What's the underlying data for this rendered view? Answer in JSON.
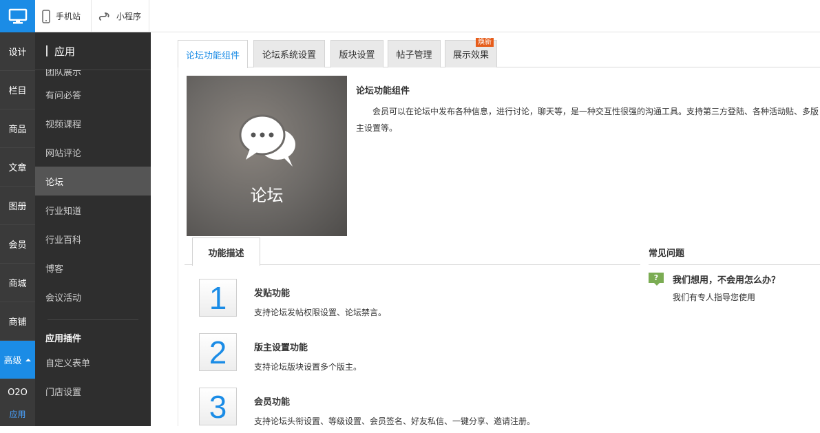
{
  "topbar": {
    "mobile_label": "手机站",
    "miniapp_label": "小程序"
  },
  "rail": {
    "items": [
      "设计",
      "栏目",
      "商品",
      "文章",
      "图册",
      "会员",
      "商城",
      "商铺"
    ],
    "active": "高级",
    "o2o": "O2O",
    "app": "应用"
  },
  "sub": {
    "title": "应用",
    "first_partial": "团队展示",
    "items": [
      "有问必答",
      "视频课程",
      "网站评论",
      "论坛",
      "行业知道",
      "行业百科",
      "博客",
      "会议活动"
    ],
    "group_title": "应用插件",
    "group_items": [
      "自定义表单",
      "门店设置"
    ]
  },
  "tabs": {
    "items": [
      "论坛功能组件",
      "论坛系统设置",
      "版块设置",
      "帖子管理",
      "展示效果"
    ],
    "badge": "焕新"
  },
  "hero": {
    "label": "论坛"
  },
  "description": {
    "title": "论坛功能组件",
    "text": "会员可以在论坛中发布各种信息，进行讨论，聊天等，是一种交互性很强的沟通工具。支持第三方登陆、各种活动贴、多版主设置等。"
  },
  "feature_tab": "功能描述",
  "features": [
    {
      "num": "1",
      "title": "发贴功能",
      "desc": "支持论坛发帖权限设置、论坛禁言。"
    },
    {
      "num": "2",
      "title": "版主设置功能",
      "desc": "支持论坛版块设置多个版主。"
    },
    {
      "num": "3",
      "title": "会员功能",
      "desc": "支持论坛头衔设置、等级设置、会员签名、好友私信、一键分享、邀请注册。"
    }
  ],
  "faq": {
    "title": "常见问题",
    "icon_text": "?",
    "question": "我们想用，不会用怎么办？",
    "answer": "我们有专人指导您使用"
  },
  "colors": {
    "accent": "#1b8ce6",
    "rail_bg": "#3a3a3a",
    "sub_bg": "#2e2e2e",
    "badge": "#e65c1a",
    "faq_icon": "#7bac53"
  }
}
